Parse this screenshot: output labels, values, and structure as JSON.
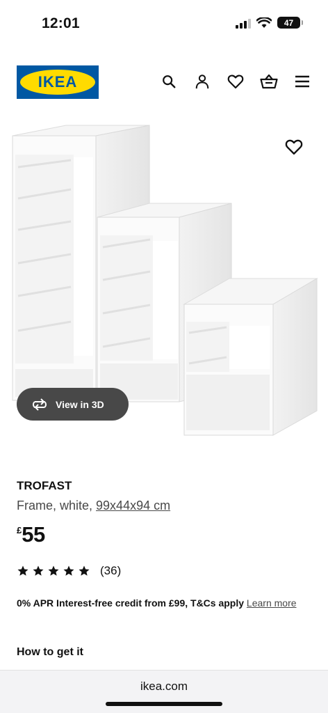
{
  "status_bar": {
    "time": "12:01",
    "battery_level": "47",
    "icons": [
      "signal-icon",
      "wifi-icon",
      "battery-icon"
    ]
  },
  "header": {
    "logo_text": "IKEA",
    "logo_colors": {
      "blue": "#0058a3",
      "yellow": "#ffdb00"
    },
    "icons": [
      "search-icon",
      "account-icon",
      "wishlist-icon",
      "basket-icon",
      "menu-icon"
    ]
  },
  "product": {
    "name": "TROFAST",
    "description_prefix": "Frame, white, ",
    "dimensions": "99x44x94 cm",
    "price_currency": "£",
    "price_value": "55",
    "rating_stars": 5,
    "rating_count": "(36)",
    "view_3d_label": "View in 3D",
    "credit_text": "0% APR Interest-free credit from £99, T&Cs apply",
    "credit_link": "Learn more",
    "how_to_get": "How to get it"
  },
  "browser": {
    "url": "ikea.com"
  }
}
